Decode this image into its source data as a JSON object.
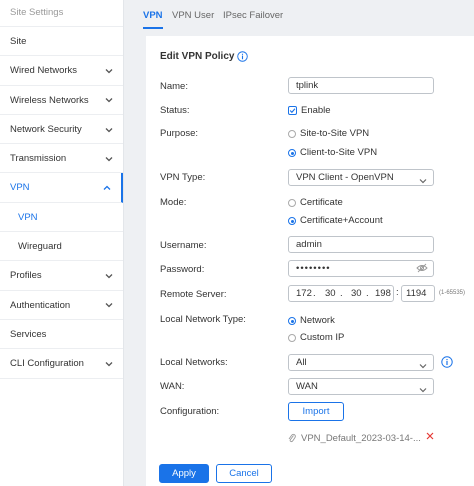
{
  "sidebar": {
    "header": "Site Settings",
    "items": [
      {
        "label": "Site",
        "chevron": ""
      },
      {
        "label": "Wired Networks",
        "chevron": "down"
      },
      {
        "label": "Wireless Networks",
        "chevron": "down"
      },
      {
        "label": "Network Security",
        "chevron": "down"
      },
      {
        "label": "Transmission",
        "chevron": "down"
      },
      {
        "label": "VPN",
        "chevron": "up"
      },
      {
        "label": "VPN",
        "chevron": ""
      },
      {
        "label": "Wireguard",
        "chevron": ""
      },
      {
        "label": "Profiles",
        "chevron": "down"
      },
      {
        "label": "Authentication",
        "chevron": "down"
      },
      {
        "label": "Services",
        "chevron": ""
      },
      {
        "label": "CLI Configuration",
        "chevron": "down"
      }
    ]
  },
  "tabs": [
    {
      "label": "VPN",
      "active": true
    },
    {
      "label": "VPN User",
      "active": false
    },
    {
      "label": "IPsec Failover",
      "active": false
    }
  ],
  "form": {
    "title": "Edit VPN Policy",
    "name": {
      "label": "Name:",
      "value": "tplink"
    },
    "status": {
      "label": "Status:",
      "option": "Enable"
    },
    "purpose": {
      "label": "Purpose:",
      "options": [
        "Site-to-Site VPN",
        "Client-to-Site VPN"
      ]
    },
    "vpn_type": {
      "label": "VPN Type:",
      "value": "VPN Client - OpenVPN"
    },
    "mode": {
      "label": "Mode:",
      "options": [
        "Certificate",
        "Certificate+Account"
      ]
    },
    "username": {
      "label": "Username:",
      "value": "admin"
    },
    "password": {
      "label": "Password:",
      "value": "••••••••"
    },
    "remote_server": {
      "label": "Remote Server:",
      "octets": [
        "172",
        "30",
        "30",
        "198"
      ],
      "port": "1194",
      "port_hint": "(1-65535)"
    },
    "local_network_type": {
      "label": "Local Network Type:",
      "options": [
        "Network",
        "Custom IP"
      ]
    },
    "local_networks": {
      "label": "Local Networks:",
      "value": "All"
    },
    "wan": {
      "label": "WAN:",
      "value": "WAN"
    },
    "configuration": {
      "label": "Configuration:",
      "button": "Import",
      "file": "VPN_Default_2023-03-14-..."
    }
  },
  "footer": {
    "apply": "Apply",
    "cancel": "Cancel"
  },
  "colors": {
    "accent": "#1a73e8",
    "delete": "#e53935"
  }
}
